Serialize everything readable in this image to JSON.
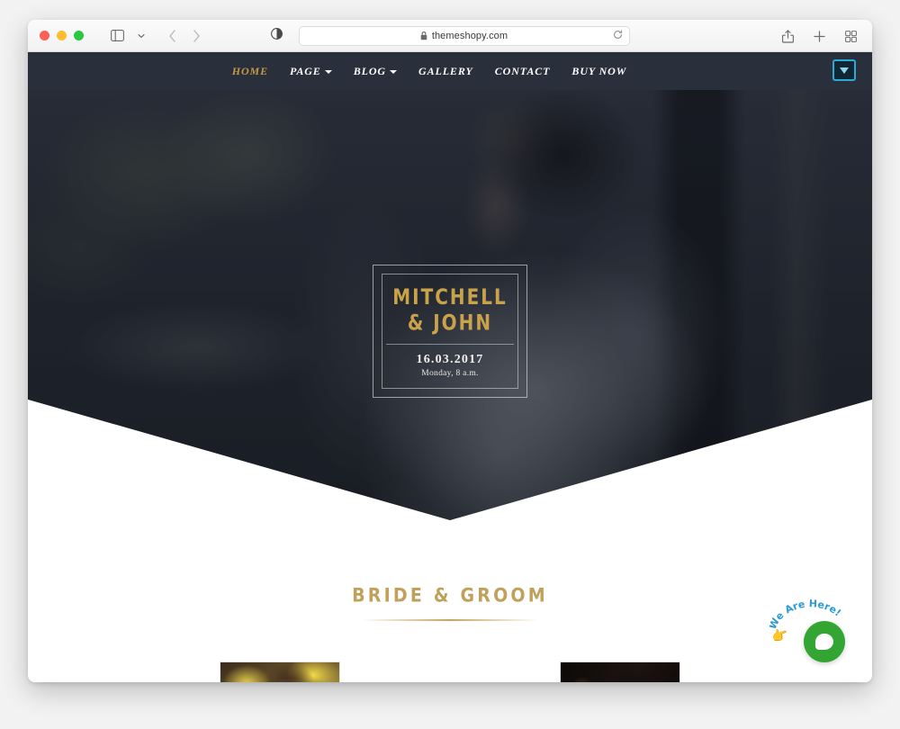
{
  "browser": {
    "window_controls": {
      "close": "close",
      "minimize": "minimize",
      "maximize": "maximize"
    },
    "sidebar_icon": "sidebar-icon",
    "sidebar_chevron_icon": "chevron-down-icon",
    "back_icon": "back-arrow-icon",
    "forward_icon": "forward-arrow-icon",
    "reader_icon": "reader-contrast-icon",
    "lock_icon": "lock-icon",
    "url": "themeshopy.com",
    "reload_icon": "reload-icon",
    "share_icon": "share-icon",
    "new_tab_icon": "plus-icon",
    "tab_overview_icon": "tab-grid-icon"
  },
  "site": {
    "nav": {
      "items": [
        {
          "label": "HOME",
          "active": true,
          "has_caret": false
        },
        {
          "label": "PAGE",
          "active": false,
          "has_caret": true
        },
        {
          "label": "BLOG",
          "active": false,
          "has_caret": true
        },
        {
          "label": "GALLERY",
          "active": false,
          "has_caret": false
        },
        {
          "label": "CONTACT",
          "active": false,
          "has_caret": false
        },
        {
          "label": "BUY NOW",
          "active": false,
          "has_caret": false
        }
      ],
      "badge_icon": "dropdown-triangle-icon"
    },
    "hero": {
      "couple_names": "MITCHELL\n& JOHN",
      "couple_line1": "MITCHELL",
      "couple_line2": "& JOHN",
      "date": "16.03.2017",
      "time": "Monday, 8 a.m.",
      "background_image": "wedding-couple-embrace-photo"
    },
    "bride_groom_section": {
      "heading": "BRIDE & GROOM",
      "bride_photo_alt": "bride-portrait-photo",
      "groom_photo_alt": "groom-portrait-photo"
    },
    "chat_widget": {
      "label": "We Are Here!",
      "hand_icon": "pointing-hand-icon",
      "bubble_icon": "chat-bubble-icon"
    }
  },
  "colors": {
    "navbar": "#2a2f3c",
    "gold": "#c49a45",
    "heading_gold": "#c0a15b",
    "chat_green": "#33a533",
    "badge_blue": "#2ea8d8"
  }
}
